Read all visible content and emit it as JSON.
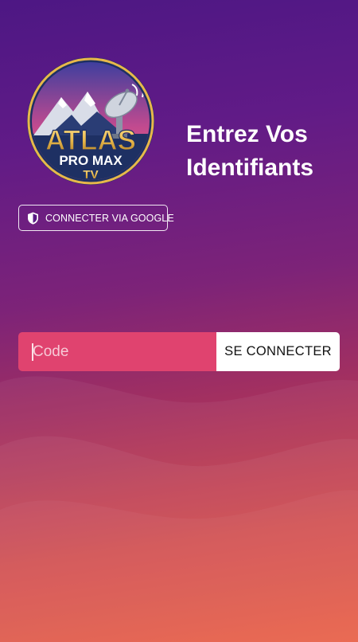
{
  "brand": {
    "logo_line1": "ATLAS",
    "logo_line2": "PRO MAX",
    "logo_line3": "TV"
  },
  "header": {
    "title_line1": "Entrez Vos",
    "title_line2": "Identifiants"
  },
  "google_login": {
    "label": "CONNECTER VIA GOOGLE",
    "icon": "shield-icon"
  },
  "login_form": {
    "code_placeholder": "Code",
    "code_value": "",
    "submit_label": "SE CONNECTER"
  },
  "colors": {
    "background_top": "#4d1784",
    "background_mid": "#7d2378",
    "background_bottom": "#e8553a",
    "input_background": "#e0436f",
    "button_background": "#ffffff",
    "logo_gold": "#e8b84a",
    "logo_navy": "#1e3063"
  }
}
